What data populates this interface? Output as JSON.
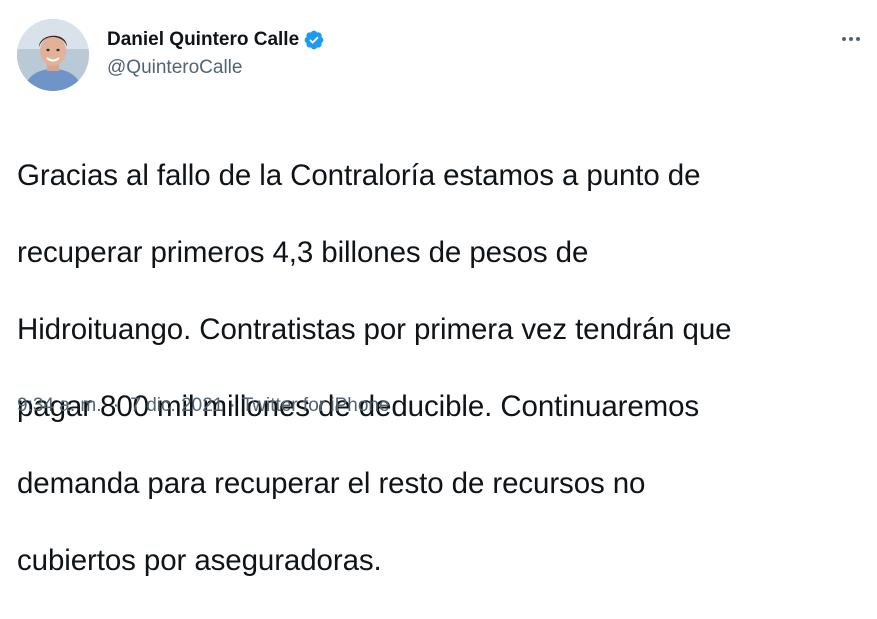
{
  "tweet": {
    "author": {
      "display_name": "Daniel Quintero Calle",
      "handle": "@QuinteroCalle",
      "verified": true
    },
    "text_lines": [
      "Gracias al fallo de la Contraloría estamos a punto de",
      "recuperar primeros 4,3 billones de pesos de",
      "Hidroituango. Contratistas por primera vez tendrán que",
      "pagar 800 mil millones de deducible. Continuaremos",
      "demanda para recuperar el resto de recursos no",
      "cubiertos por aseguradoras."
    ],
    "meta": {
      "time": "9:34 a. m.",
      "separator": "·",
      "date": "7 dic. 2021",
      "source": "Twitter for iPhone"
    }
  },
  "icons": {
    "verified": "verified-badge-icon",
    "more": "more-options-icon"
  },
  "colors": {
    "text": "#0f1419",
    "secondary": "#536471",
    "verified": "#1d9bf0",
    "background": "#ffffff"
  }
}
